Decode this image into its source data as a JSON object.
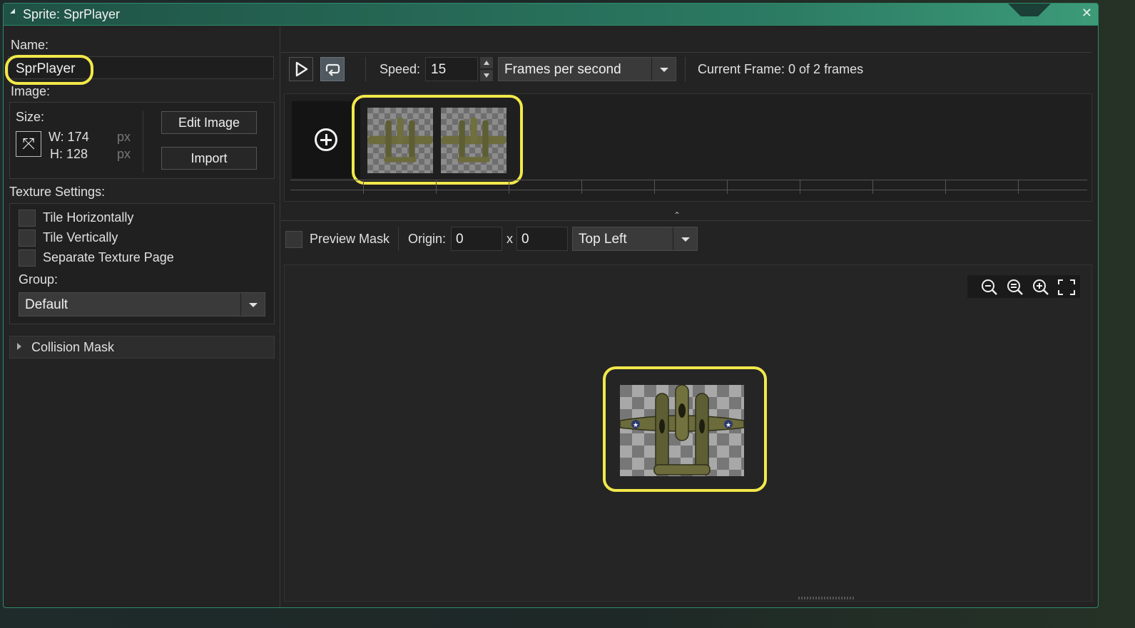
{
  "window": {
    "title": "Sprite: SprPlayer",
    "close_icon": "close-icon"
  },
  "left": {
    "name_label": "Name:",
    "name_value": "SprPlayer",
    "image_label": "Image:",
    "size_label": "Size:",
    "width_text": "W: 174",
    "height_text": "H: 128",
    "unit_w": "px",
    "unit_h": "px",
    "edit_image": "Edit Image",
    "import": "Import",
    "texture_label": "Texture Settings:",
    "checks": [
      "Tile Horizontally",
      "Tile Vertically",
      "Separate Texture Page"
    ],
    "group_label": "Group:",
    "group_value": "Default",
    "collision_label": "Collision Mask"
  },
  "toolbar": {
    "speed_label": "Speed:",
    "speed_value": "15",
    "speed_mode": "Frames per second",
    "current_frame": "Current Frame: 0 of 2 frames"
  },
  "origin": {
    "preview_mask": "Preview Mask",
    "origin_label": "Origin:",
    "x_value": "0",
    "x_sep": "x",
    "y_value": "0",
    "anchor": "Top Left"
  },
  "frames": {
    "count": 2
  },
  "colors": {
    "highlight": "#f2e84a",
    "titlebar": "#2b7a62",
    "plane": "#6b6b3c"
  }
}
